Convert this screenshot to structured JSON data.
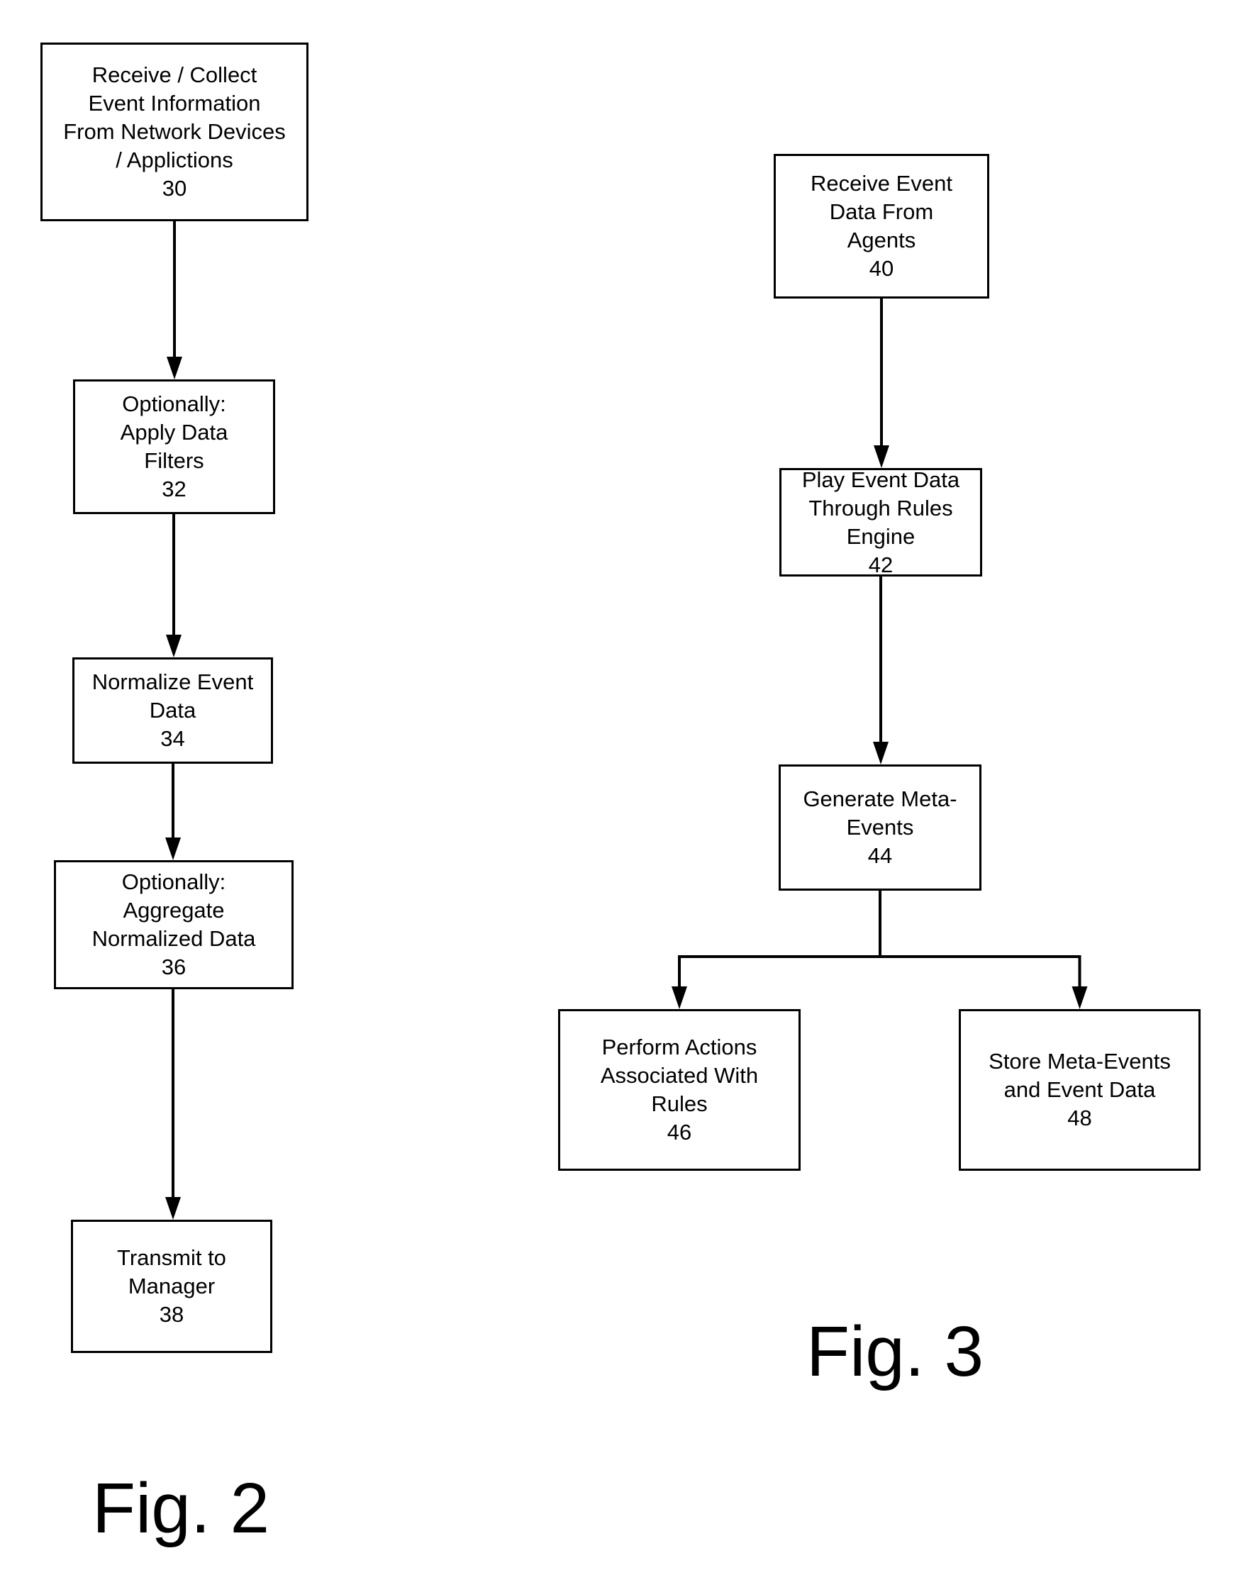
{
  "figures": [
    {
      "label": "Fig. 2",
      "steps": [
        {
          "id": "30",
          "lines": [
            "Receive / Collect",
            "Event Information",
            "From Network Devices",
            "/ Applictions"
          ],
          "ref": "30"
        },
        {
          "id": "32",
          "lines": [
            "Optionally:",
            "Apply Data",
            "Filters"
          ],
          "ref": "32"
        },
        {
          "id": "34",
          "lines": [
            "Normalize Event",
            "Data"
          ],
          "ref": "34"
        },
        {
          "id": "36",
          "lines": [
            "Optionally:",
            "Aggregate",
            "Normalized Data"
          ],
          "ref": "36"
        },
        {
          "id": "38",
          "lines": [
            "Transmit to",
            "Manager"
          ],
          "ref": "38"
        }
      ],
      "edges": [
        [
          "30",
          "32"
        ],
        [
          "32",
          "34"
        ],
        [
          "34",
          "36"
        ],
        [
          "36",
          "38"
        ]
      ]
    },
    {
      "label": "Fig. 3",
      "steps": [
        {
          "id": "40",
          "lines": [
            "Receive Event",
            "Data From",
            "Agents"
          ],
          "ref": "40"
        },
        {
          "id": "42",
          "lines": [
            "Play Event Data",
            "Through Rules",
            "Engine"
          ],
          "ref": "42"
        },
        {
          "id": "44",
          "lines": [
            "Generate Meta-",
            "Events"
          ],
          "ref": "44"
        },
        {
          "id": "46",
          "lines": [
            "Perform Actions",
            "Associated With",
            "Rules"
          ],
          "ref": "46"
        },
        {
          "id": "48",
          "lines": [
            "Store Meta-Events",
            "and Event Data"
          ],
          "ref": "48"
        }
      ],
      "edges": [
        [
          "40",
          "42"
        ],
        [
          "42",
          "44"
        ],
        [
          "44",
          "46"
        ],
        [
          "44",
          "48"
        ]
      ]
    }
  ],
  "colors": {
    "ink": "#000000",
    "background": "#ffffff"
  }
}
